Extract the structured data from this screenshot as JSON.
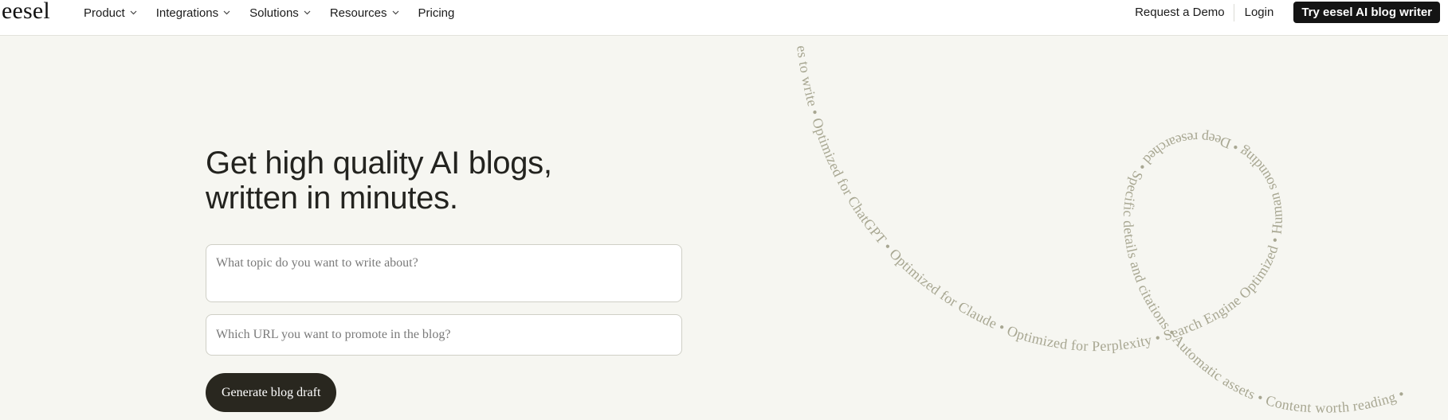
{
  "brand": {
    "logo_text": "eesel"
  },
  "nav": {
    "items": [
      {
        "label": "Product",
        "has_dropdown": true
      },
      {
        "label": "Integrations",
        "has_dropdown": true
      },
      {
        "label": "Solutions",
        "has_dropdown": true
      },
      {
        "label": "Resources",
        "has_dropdown": true
      },
      {
        "label": "Pricing",
        "has_dropdown": false
      }
    ],
    "request_demo": "Request a Demo",
    "login": "Login",
    "cta": "Try eesel AI blog writer"
  },
  "hero": {
    "headline_line1": "Get high quality AI blogs,",
    "headline_line2": "written in minutes.",
    "topic_placeholder": "What topic do you want to write about?",
    "url_placeholder": "Which URL you want to promote in the blog?",
    "generate_label": "Generate blog draft"
  },
  "decor": {
    "ribbon_text": "es to write • Optimized for ChatGPT • Optimized for Claude • Optimized for Perplexity • Search Engine Optimized • Human sounding • Deep researched • Specific details and citations • Automatic assets • Content worth reading •"
  },
  "colors": {
    "background": "#f6f6f1",
    "cta_background": "#141414",
    "generate_button": "#29271f",
    "ribbon_text": "#a8a792"
  }
}
